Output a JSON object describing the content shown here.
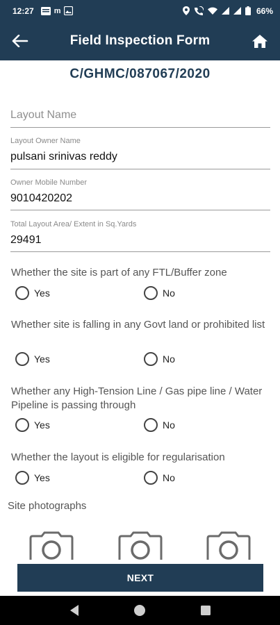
{
  "status_bar": {
    "time": "12:27",
    "left_icons": [
      "notification-icon",
      "m",
      "gallery-icon"
    ],
    "right_icons": [
      "location-icon",
      "wifi-call-icon",
      "wifi-icon",
      "signal-icon",
      "signal-icon",
      "battery-icon"
    ],
    "battery": "66%"
  },
  "appbar": {
    "title": "Field Inspection Form",
    "back_icon": "arrow-left-icon",
    "home_icon": "home-icon"
  },
  "application_number": "C/GHMC/087067/2020",
  "fields": {
    "layout_name": {
      "placeholder": "Layout Name",
      "value": ""
    },
    "owner_name": {
      "label": "Layout Owner Name",
      "value": "pulsani srinivas reddy"
    },
    "owner_mobile": {
      "label": "Owner Mobile Number",
      "value": "9010420202"
    },
    "total_area": {
      "label": "Total Layout Area/ Extent in Sq.Yards",
      "value": "29491"
    }
  },
  "questions": [
    {
      "text": "Whether the site is part of any FTL/Buffer zone",
      "yes": "Yes",
      "no": "No",
      "selected": null
    },
    {
      "text": "Whether site is falling in any Govt land or prohibited list",
      "yes": "Yes",
      "no": "No",
      "selected": null
    },
    {
      "text": "Whether any High-Tension Line / Gas pipe line / Water Pipeline is passing through",
      "yes": "Yes",
      "no": "No",
      "selected": null
    },
    {
      "text": "Whether the layout is eligible for regularisation",
      "yes": "Yes",
      "no": "No",
      "selected": null
    }
  ],
  "site_photos": {
    "label": "Site photographs",
    "slots": [
      "camera-icon",
      "camera-icon",
      "camera-icon"
    ]
  },
  "next_button": "NEXT",
  "nav": [
    "back-icon",
    "home-icon",
    "recents-icon"
  ],
  "colors": {
    "primary": "#213d55",
    "text_muted": "#555555"
  }
}
